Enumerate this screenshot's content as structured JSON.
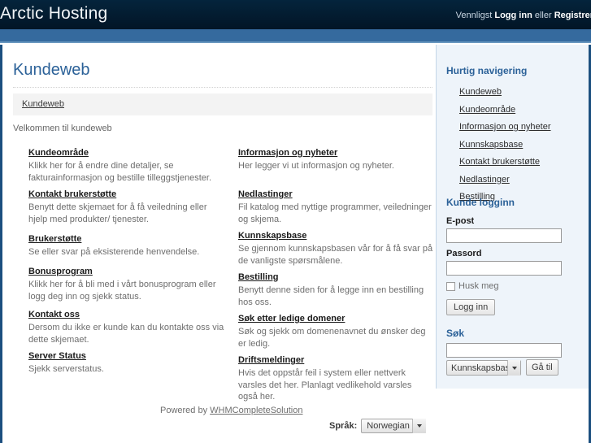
{
  "header": {
    "brand": "Arctic Hosting",
    "login_prefix": "Vennligst ",
    "login_link": "Logg inn",
    "login_mid": " eller ",
    "register_link": "Registrer"
  },
  "main": {
    "page_title": "Kundeweb",
    "breadcrumb": "Kundeweb",
    "welcome": "Velkommen til kundeweb",
    "items_left": [
      {
        "title": "Kundeområde",
        "desc": "Klikk her for å endre dine detaljer, se fakturainformasjon og bestille tilleggstjenester."
      },
      {
        "title": "Kontakt brukerstøtte",
        "desc": "Benytt dette skjemaet for å få veiledning eller hjelp med produkter/ tjenester."
      },
      {
        "title": "Brukerstøtte",
        "desc": "Se eller svar på eksisterende henvendelse."
      },
      {
        "title": "Bonusprogram",
        "desc": "Klikk her for å bli med i vårt bonusprogram eller logg deg inn og sjekk status."
      },
      {
        "title": "Kontakt oss",
        "desc": "Dersom du ikke er kunde kan du kontakte oss via dette skjemaet."
      },
      {
        "title": "Server Status",
        "desc": "Sjekk serverstatus."
      }
    ],
    "items_right": [
      {
        "title": "Informasjon og nyheter",
        "desc": "Her legger vi ut informasjon og nyheter."
      },
      {
        "title": "Nedlastinger",
        "desc": "Fil katalog med nyttige programmer, veiledninger og skjema."
      },
      {
        "title": "Kunnskapsbase",
        "desc": "Se gjennom kunnskapsbasen vår for å få svar på de vanligste spørsmålene."
      },
      {
        "title": "Bestilling",
        "desc": "Benytt denne siden for å legge inn en bestilling hos oss."
      },
      {
        "title": "Søk etter ledige domener",
        "desc": "Søk og sjekk om domenenavnet du ønsker deg er ledig."
      },
      {
        "title": "Driftsmeldinger",
        "desc": "Hvis det oppstår feil i system eller nettverk varsles det her. Planlagt vedlikehold varsles også her."
      }
    ]
  },
  "sidebar": {
    "nav_heading": "Hurtig navigering",
    "nav_items": [
      "Kundeweb",
      "Kundeområde",
      "Informasjon og nyheter",
      "Kunnskapsbase",
      "Kontakt brukerstøtte",
      "Nedlastinger",
      "Bestilling"
    ],
    "login_heading": "Kunde logginn",
    "email_label": "E-post",
    "email_value": "",
    "password_label": "Passord",
    "password_value": "",
    "remember_label": "Husk meg",
    "login_button": "Logg inn",
    "search_heading": "Søk",
    "search_value": "",
    "search_scope": "Kunnskapsbase",
    "search_button": "Gå til"
  },
  "footer": {
    "powered_prefix": "Powered by ",
    "powered_link": "WHMCompleteSolution",
    "language_label": "Språk:",
    "language_value": "Norwegian"
  },
  "colors": {
    "header_bg": "#041c30",
    "band_blue": "#356a9e",
    "accent": "#2b6198",
    "border_blue": "#1c4f7f",
    "sidebar_bg": "#eef4fa"
  }
}
